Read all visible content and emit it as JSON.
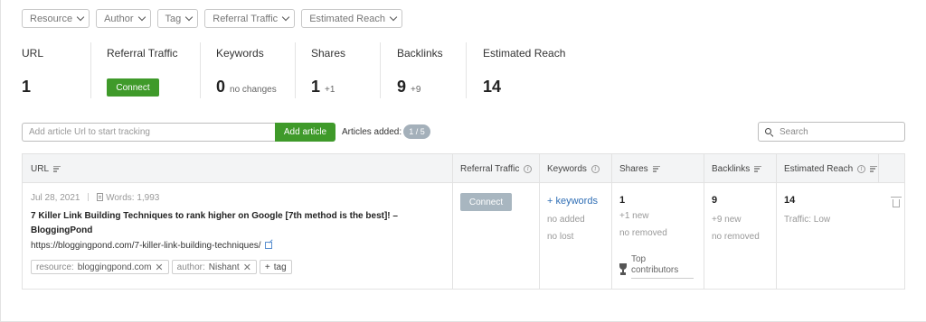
{
  "filters": [
    {
      "label": "Resource"
    },
    {
      "label": "Author"
    },
    {
      "label": "Tag"
    },
    {
      "label": "Referral Traffic"
    },
    {
      "label": "Estimated Reach"
    }
  ],
  "metrics": {
    "url": {
      "label": "URL",
      "value": "1"
    },
    "referral": {
      "label": "Referral Traffic",
      "button": "Connect"
    },
    "keywords": {
      "label": "Keywords",
      "value": "0",
      "sub": "no changes"
    },
    "shares": {
      "label": "Shares",
      "value": "1",
      "sub": "+1"
    },
    "backlinks": {
      "label": "Backlinks",
      "value": "9",
      "sub": "+9"
    },
    "reach": {
      "label": "Estimated Reach",
      "value": "14"
    }
  },
  "tracking": {
    "placeholder": "Add article Url to start tracking",
    "add_label": "Add article",
    "added_label": "Articles added:",
    "added_count": "1 / 5"
  },
  "search": {
    "placeholder": "Search"
  },
  "table": {
    "headers": {
      "url": "URL",
      "referral": "Referral Traffic",
      "keywords": "Keywords",
      "shares": "Shares",
      "backlinks": "Backlinks",
      "reach": "Estimated Reach"
    },
    "row": {
      "date": "Jul 28, 2021",
      "words": "Words: 1,993",
      "title": "7 Killer Link Building Techniques to rank higher on Google [7th method is the best]! – BloggingPond",
      "url": "https://bloggingpond.com/7-killer-link-building-techniques/",
      "tags": [
        {
          "key": "resource:",
          "value": "bloggingpond.com"
        },
        {
          "key": "author:",
          "value": "Nishant"
        }
      ],
      "add_tag": "tag",
      "referral_button": "Connect",
      "keywords_link": "+ keywords",
      "keywords_added": "no added",
      "keywords_lost": "no lost",
      "shares_value": "1",
      "shares_new": "+1 new",
      "shares_removed": "no removed",
      "shares_contributors": "Top contributors",
      "backlinks_value": "9",
      "backlinks_new": "+9 new",
      "backlinks_removed": "no removed",
      "reach_value": "14",
      "reach_traffic": "Traffic: Low"
    }
  }
}
